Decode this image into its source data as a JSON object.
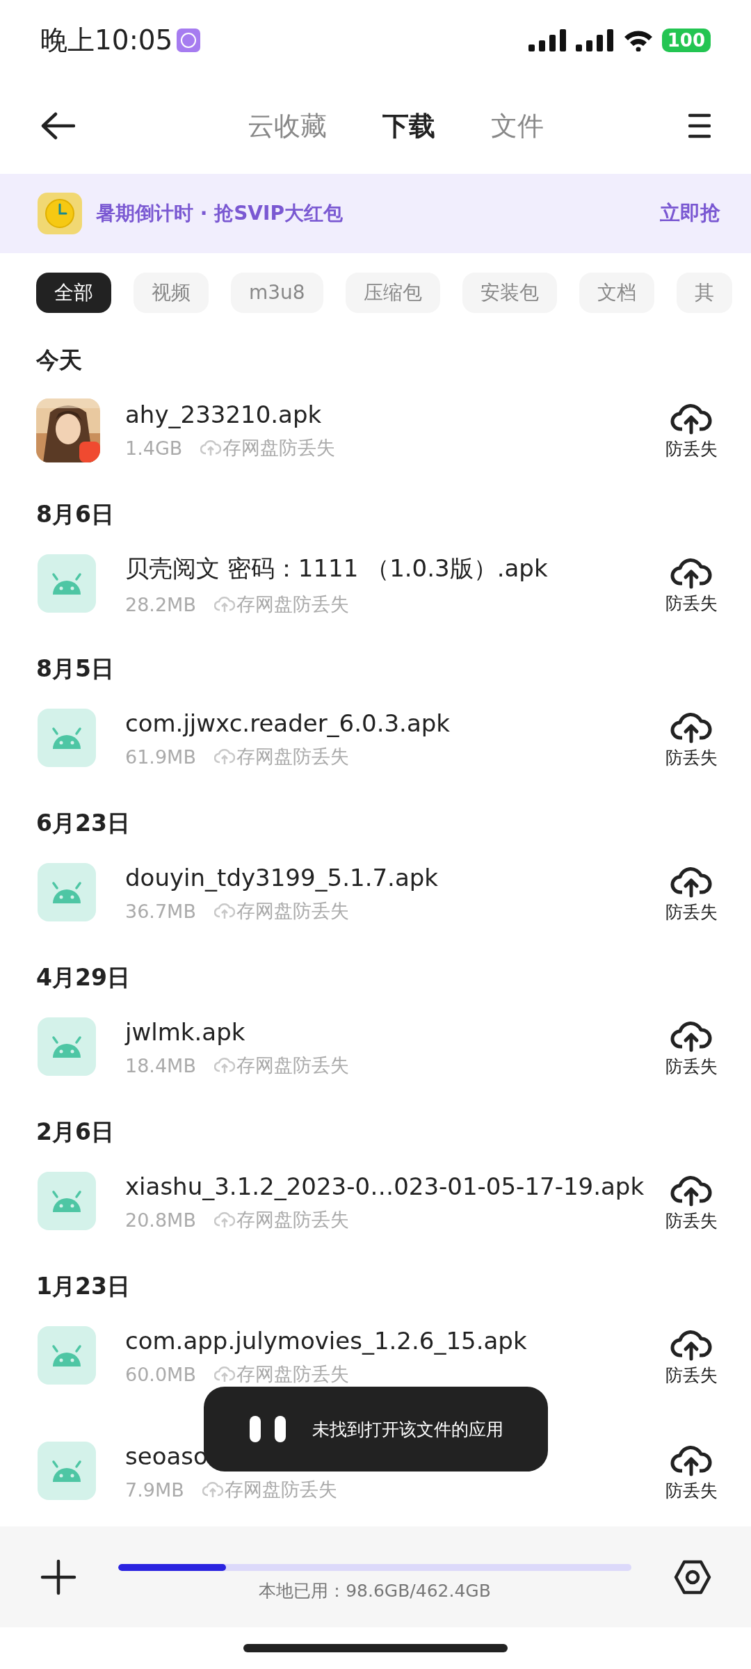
{
  "status_bar": {
    "time": "晚上10:05",
    "battery": "100"
  },
  "header": {
    "tabs": [
      {
        "label": "云收藏",
        "selected": false
      },
      {
        "label": "下载",
        "selected": true
      },
      {
        "label": "文件",
        "selected": false
      }
    ]
  },
  "banner": {
    "text": "暑期倒计时 · 抢SVIP大红包",
    "action": "立即抢"
  },
  "filters": [
    {
      "label": "全部",
      "selected": true
    },
    {
      "label": "视频",
      "selected": false
    },
    {
      "label": "m3u8",
      "selected": false
    },
    {
      "label": "压缩包",
      "selected": false
    },
    {
      "label": "安装包",
      "selected": false
    },
    {
      "label": "文档",
      "selected": false
    },
    {
      "label": "其",
      "selected": false
    }
  ],
  "groups": [
    {
      "date": "今天",
      "items": [
        {
          "kind": "picture",
          "name": "ahy_233210.apk",
          "size": "1.4GB",
          "backup": "存网盘防丢失",
          "action": "防丢失"
        }
      ]
    },
    {
      "date": "8月6日",
      "items": [
        {
          "kind": "android",
          "name": "贝壳阅文 密码：1111 （1.0.3版）.apk",
          "size": "28.2MB",
          "backup": "存网盘防丢失",
          "action": "防丢失"
        }
      ]
    },
    {
      "date": "8月5日",
      "items": [
        {
          "kind": "android",
          "name": "com.jjwxc.reader_6.0.3.apk",
          "size": "61.9MB",
          "backup": "存网盘防丢失",
          "action": "防丢失"
        }
      ]
    },
    {
      "date": "6月23日",
      "items": [
        {
          "kind": "android",
          "name": "douyin_tdy3199_5.1.7.apk",
          "size": "36.7MB",
          "backup": "存网盘防丢失",
          "action": "防丢失"
        }
      ]
    },
    {
      "date": "4月29日",
      "items": [
        {
          "kind": "android",
          "name": "jwlmk.apk",
          "size": "18.4MB",
          "backup": "存网盘防丢失",
          "action": "防丢失"
        }
      ]
    },
    {
      "date": "2月6日",
      "items": [
        {
          "kind": "android",
          "name": "xiashu_3.1.2_2023-0…023-01-05-17-19.apk",
          "size": "20.8MB",
          "backup": "存网盘防丢失",
          "action": "防丢失"
        }
      ]
    },
    {
      "date": "1月23日",
      "items": [
        {
          "kind": "android",
          "name": "com.app.julymovies_1.2.6_15.apk",
          "size": "60.0MB",
          "backup": "存网盘防丢失",
          "action": "防丢失"
        },
        {
          "kind": "android",
          "name": "seoaso",
          "size": "7.9MB",
          "backup": "存网盘防丢失",
          "action": "防丢失"
        }
      ]
    }
  ],
  "toast": {
    "text": "未找到打开该文件的应用"
  },
  "storage": {
    "text": "本地已用：98.6GB/462.4GB",
    "level": 0.21
  }
}
